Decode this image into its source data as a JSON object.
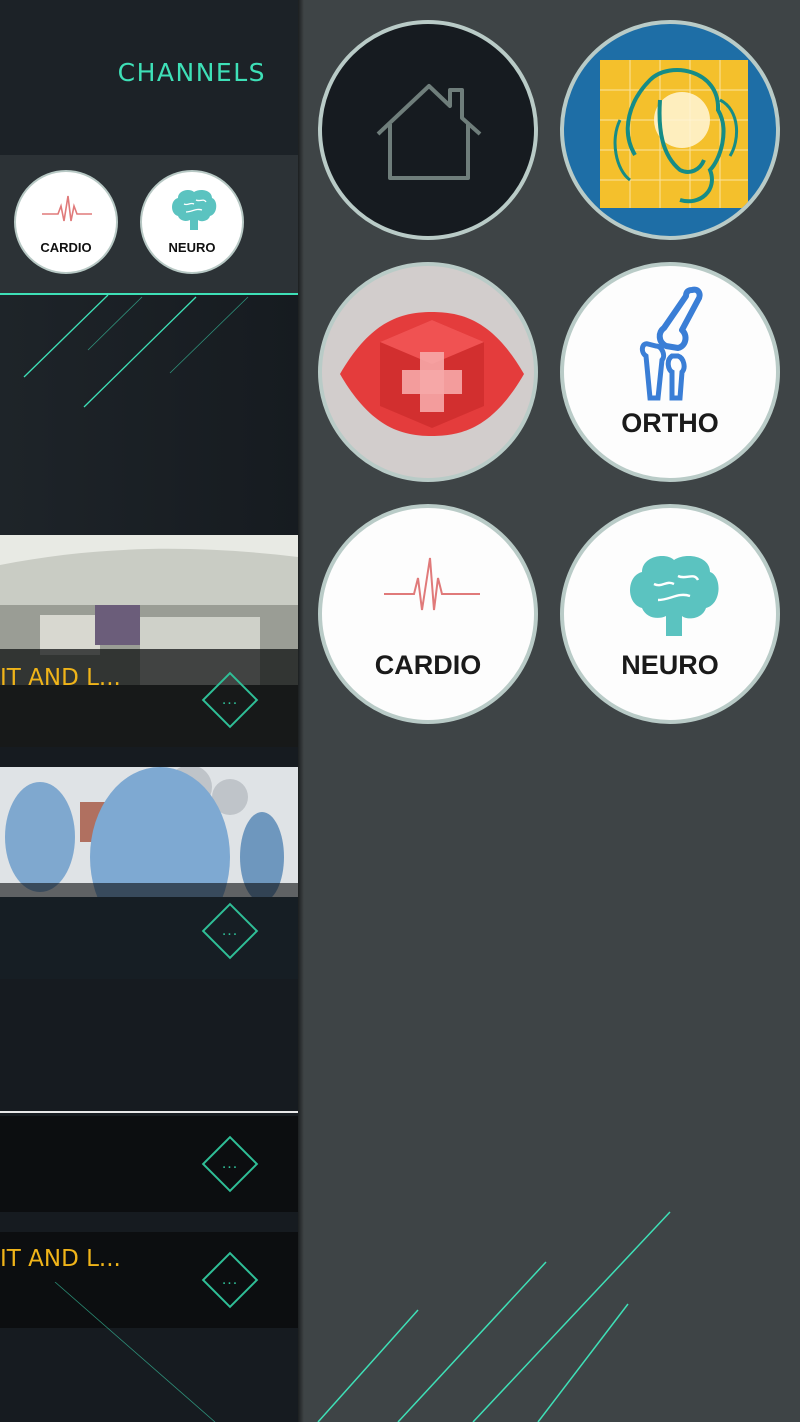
{
  "sidebar": {
    "title": "CHANNELS",
    "mini_channels": [
      {
        "label": "CARDIO",
        "icon": "heartbeat-icon"
      },
      {
        "label": "NEURO",
        "icon": "brain-icon"
      }
    ],
    "videos": [
      {
        "title": "IT AND L...",
        "more": "..."
      },
      {
        "title": "",
        "more": "..."
      }
    ],
    "list_items": [
      {
        "title": "",
        "more": "..."
      },
      {
        "title": "IT AND L...",
        "more": "..."
      }
    ]
  },
  "channels": [
    {
      "label": "",
      "icon": "home-icon"
    },
    {
      "label": "",
      "icon": "venus-art-logo"
    },
    {
      "label": "",
      "icon": "medical-cross-gem-icon"
    },
    {
      "label": "ORTHO",
      "icon": "knee-bone-icon"
    },
    {
      "label": "CARDIO",
      "icon": "heartbeat-icon"
    },
    {
      "label": "NEURO",
      "icon": "brain-icon"
    }
  ],
  "colors": {
    "accent": "#3ee0b7",
    "title_yellow": "#f0b419",
    "panel": "#3e4446",
    "sidebar": "#161b20"
  }
}
